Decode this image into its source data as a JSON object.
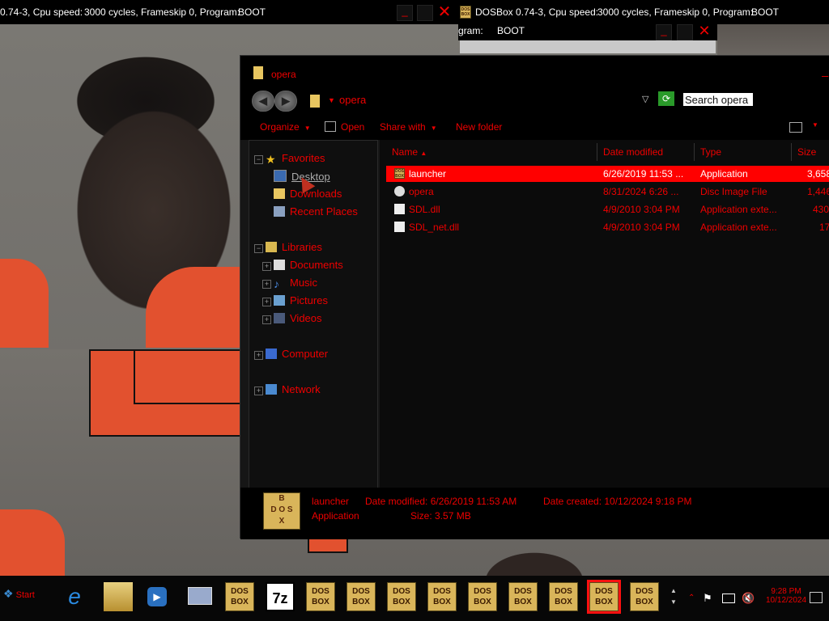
{
  "dosbox_bar1": {
    "left_text": "0.74-3, Cpu speed:",
    "cycles": "3000 cycles, Frameskip  0, Program:",
    "program": "BOOT"
  },
  "dosbox_bar2": {
    "title": "DOSBox 0.74-3, Cpu speed:",
    "cycles": "3000 cycles, Frameskip  0, Program:",
    "program": "BOOT"
  },
  "dosbox_bar3": {
    "prefix": "gram:",
    "program": "BOOT"
  },
  "window": {
    "title": "opera"
  },
  "nav": {
    "address": "opera",
    "search_placeholder": "Search opera"
  },
  "commands": {
    "organize": "Organize",
    "open": "Open",
    "share": "Share with",
    "new_folder": "New folder"
  },
  "sidebar": {
    "favorites": "Favorites",
    "desktop": "Desktop",
    "downloads": "Downloads",
    "recent": "Recent Places",
    "libraries": "Libraries",
    "documents": "Documents",
    "music": "Music",
    "pictures": "Pictures",
    "videos": "Videos",
    "computer": "Computer",
    "network": "Network"
  },
  "columns": {
    "name": "Name",
    "date": "Date modified",
    "type": "Type",
    "size": "Size"
  },
  "files": [
    {
      "name": "launcher",
      "date": "6/26/2019 11:53 ...",
      "type": "Application",
      "size": "3,658"
    },
    {
      "name": "opera",
      "date": "8/31/2024 6:26 ...",
      "type": "Disc Image File",
      "size": "1,446"
    },
    {
      "name": "SDL.dll",
      "date": "4/9/2010 3:04 PM",
      "type": "Application exte...",
      "size": "430"
    },
    {
      "name": "SDL_net.dll",
      "date": "4/9/2010 3:04 PM",
      "type": "Application exte...",
      "size": "17"
    }
  ],
  "details": {
    "name": "launcher",
    "kind": "Application",
    "modified": "Date modified: 6/26/2019 11:53 AM",
    "size": "Size: 3.57 MB",
    "created": "Date created: 10/12/2024 9:18 PM"
  },
  "taskbar": {
    "start": "Start",
    "time": "9:28 PM",
    "date": "10/12/2024"
  },
  "icons": {
    "dosbox_label": "DOS BOX",
    "sevenzip_label": "7z"
  }
}
